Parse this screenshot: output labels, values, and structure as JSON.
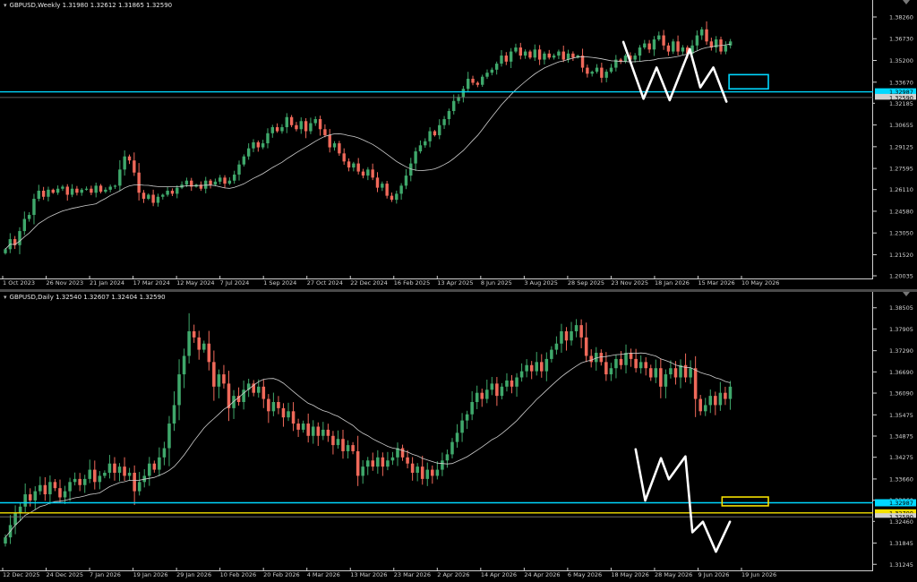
{
  "colors": {
    "background": "#000000",
    "bull": "#3fa86b",
    "bear": "#f0695a",
    "ma": "#cfcfcf",
    "cyan": "#00d8ff",
    "yellow": "#f5e000",
    "white_pattern": "#ffffff",
    "price_line": "#777777"
  },
  "panels": [
    {
      "id": "weekly",
      "title": "GBPUSD,Weekly  1.31980 1.32612 1.31865 1.32590",
      "y_ticks": [
        "1.38260",
        "1.36730",
        "1.35200",
        "1.33670",
        "1.32185",
        "1.30655",
        "1.29125",
        "1.27595",
        "1.26110",
        "1.24580",
        "1.23050",
        "1.21520",
        "1.20035"
      ],
      "y_range": [
        1.20035,
        1.387
      ],
      "x_ticks": [
        "1 Oct 2023",
        "26 Nov 2023",
        "21 Jan 2024",
        "17 Mar 2024",
        "12 May 2024",
        "7 Jul 2024",
        "1 Sep 2024",
        "27 Oct 2024",
        "22 Dec 2024",
        "16 Feb 2025",
        "13 Apr 2025",
        "8 Jun 2025",
        "3 Aug 2025",
        "28 Sep 2025",
        "23 Nov 2025",
        "18 Jan 2026",
        "15 Mar 2026",
        "10 May 2026"
      ],
      "current_price": 1.3259,
      "badges": [
        {
          "label": "1.32987",
          "value": 1.32987,
          "color": "#00d8ff",
          "text_color": "#000000"
        },
        {
          "label": "1.32590",
          "value": 1.3259,
          "color": "#d0d0d0",
          "text_color": "#000000"
        },
        {
          "label": "1.32185",
          "value": 1.32185,
          "color": "#000000",
          "text_color": "#d0d0d0"
        }
      ],
      "hlines": [
        {
          "value": 1.32987,
          "color": "#00d8ff"
        },
        {
          "value": 1.3259,
          "color": "#777777"
        }
      ],
      "box": {
        "y_top": 1.342,
        "y_bottom": 1.332,
        "color": "#00d8ff",
        "start": 0.835,
        "end": 0.88
      },
      "zigzag": [
        [
          0.714,
          1.365
        ],
        [
          0.737,
          1.325
        ],
        [
          0.752,
          1.347
        ],
        [
          0.767,
          1.324
        ],
        [
          0.79,
          1.36
        ],
        [
          0.802,
          1.333
        ],
        [
          0.817,
          1.347
        ],
        [
          0.832,
          1.323
        ]
      ],
      "series": {
        "start_price": 1.213,
        "ma_period": 20,
        "moves": [
          0.004,
          0.01,
          -0.006,
          0.014,
          0.012,
          0.004,
          0.016,
          0.008,
          -0.006,
          0.007,
          -0.003,
          0.004,
          0.002,
          -0.008,
          0.006,
          -0.004,
          0.003,
          0.001,
          -0.004,
          0.007,
          -0.006,
          0.002,
          0.003,
          0.001,
          0.016,
          0.013,
          -0.004,
          -0.012,
          -0.02,
          -0.006,
          0.004,
          -0.008,
          0.006,
          0.002,
          0.004,
          -0.003,
          0.006,
          0.003,
          0.004,
          -0.006,
          0.002,
          -0.004,
          0.008,
          -0.004,
          0.003,
          0.004,
          -0.006,
          0.003,
          0.006,
          0.01,
          0.008,
          0.008,
          0.006,
          -0.005,
          0.004,
          0.01,
          0.006,
          -0.004,
          0.004,
          0.01,
          -0.008,
          -0.004,
          0.008,
          -0.01,
          0.008,
          0.004,
          -0.01,
          -0.006,
          -0.012,
          0.004,
          -0.01,
          -0.008,
          -0.006,
          0.004,
          -0.008,
          -0.004,
          0.006,
          -0.008,
          -0.01,
          0.004,
          -0.012,
          -0.004,
          0.006,
          0.008,
          0.01,
          0.012,
          0.012,
          0.006,
          0.004,
          0.01,
          -0.004,
          0.01,
          0.006,
          0.008,
          0.01,
          0.004,
          0.008,
          0.01,
          -0.004,
          -0.002,
          0.008,
          0.004,
          0.003,
          0.006,
          0.008,
          -0.006,
          0.01,
          0.004,
          -0.008,
          0.004,
          -0.006,
          0.008,
          -0.01,
          0.006,
          -0.004,
          0.002,
          0.004,
          -0.008,
          0.006,
          -0.004,
          0.002,
          -0.012,
          -0.006,
          0.002,
          0.004,
          -0.01,
          0.006,
          0.004,
          0.008,
          -0.002,
          0.006,
          -0.004,
          0.004,
          0.008,
          0.004,
          -0.006,
          0.01,
          0.004,
          -0.01,
          -0.006,
          0.01,
          -0.01,
          0.004,
          -0.006,
          0.008,
          0.01,
          0.006,
          -0.012,
          -0.006,
          0.008,
          -0.012,
          0.006,
          0.004
        ]
      }
    },
    {
      "id": "daily",
      "title": "GBPUSD,Daily  1.32540 1.32607 1.32404 1.32590",
      "y_ticks": [
        "1.38505",
        "1.37905",
        "1.37290",
        "1.36690",
        "1.36090",
        "1.35475",
        "1.34875",
        "1.34275",
        "1.33660",
        "1.33060",
        "1.32460",
        "1.31845",
        "1.31245"
      ],
      "y_range": [
        1.3115,
        1.3865
      ],
      "x_ticks": [
        "12 Dec 2025",
        "24 Dec 2025",
        "7 Jan 2026",
        "19 Jan 2026",
        "29 Jan 2026",
        "10 Feb 2026",
        "20 Feb 2026",
        "4 Mar 2026",
        "13 Mar 2026",
        "23 Mar 2026",
        "2 Apr 2026",
        "14 Apr 2026",
        "24 Apr 2026",
        "6 May 2026",
        "18 May 2026",
        "28 May 2026",
        "9 Jun 2026",
        "19 Jun 2026"
      ],
      "current_price": 1.3259,
      "badges": [
        {
          "label": "1.32987",
          "value": 1.32987,
          "color": "#00d8ff",
          "text_color": "#000000"
        },
        {
          "label": "1.32700",
          "value": 1.327,
          "color": "#f5e000",
          "text_color": "#000000"
        },
        {
          "label": "1.32590",
          "value": 1.3259,
          "color": "#d0d0d0",
          "text_color": "#000000"
        },
        {
          "label": "1.32460",
          "value": 1.3246,
          "color": "#000000",
          "text_color": "#d0d0d0"
        }
      ],
      "hlines": [
        {
          "value": 1.32987,
          "color": "#00d8ff"
        },
        {
          "value": 1.327,
          "color": "#f5e000"
        },
        {
          "value": 1.3259,
          "color": "#777777"
        }
      ],
      "box": {
        "y_top": 1.3315,
        "y_bottom": 1.329,
        "color": "#f5e000",
        "start": 0.827,
        "end": 0.88
      },
      "zigzag": [
        [
          0.728,
          1.345
        ],
        [
          0.739,
          1.3305
        ],
        [
          0.757,
          1.3425
        ],
        [
          0.766,
          1.3365
        ],
        [
          0.785,
          1.343
        ],
        [
          0.793,
          1.3215
        ],
        [
          0.805,
          1.3245
        ],
        [
          0.82,
          1.316
        ],
        [
          0.836,
          1.3245
        ]
      ],
      "series": {
        "start_price": 1.336,
        "ma_period": 20,
        "moves": [
          0.002,
          0.004,
          0.004,
          0.002,
          0.004,
          -0.002,
          0.003,
          0.002,
          -0.003,
          0.004,
          -0.002,
          -0.003,
          0.002,
          0.003,
          0.001,
          -0.002,
          0.002,
          0.003,
          -0.004,
          0.002,
          0.001,
          0.003,
          -0.003,
          0.002,
          -0.003,
          0.001,
          -0.006,
          0.003,
          0.002,
          0.004,
          -0.002,
          0.004,
          0.003,
          0.008,
          0.006,
          0.01,
          0.006,
          0.008,
          -0.002,
          -0.004,
          0.002,
          -0.006,
          -0.008,
          0.004,
          -0.003,
          -0.008,
          0.004,
          -0.002,
          0.004,
          0.002,
          -0.003,
          0.002,
          -0.004,
          -0.004,
          0.003,
          -0.002,
          -0.003,
          0.002,
          -0.004,
          -0.002,
          0.002,
          -0.004,
          0.003,
          -0.003,
          0.002,
          -0.002,
          -0.003,
          0.002,
          -0.004,
          0.002,
          -0.002,
          -0.008,
          0.003,
          0.002,
          -0.002,
          0.003,
          -0.003,
          0.002,
          0.001,
          0.003,
          -0.003,
          -0.002,
          -0.003,
          0.002,
          -0.004,
          0.003,
          -0.002,
          0.002,
          0.003,
          0.002,
          0.004,
          0.003,
          0.004,
          0.002,
          0.004,
          0.003,
          -0.002,
          0.003,
          0.002,
          -0.004,
          0.003,
          0.002,
          -0.002,
          0.003,
          0.002,
          0.002,
          -0.002,
          0.003,
          -0.003,
          0.004,
          0.003,
          0.002,
          0.004,
          -0.003,
          0.003,
          0.002,
          -0.004,
          -0.006,
          -0.002,
          0.003,
          -0.003,
          -0.004,
          0.002,
          0.003,
          -0.002,
          0.004,
          -0.002,
          -0.003,
          0.002,
          -0.002,
          -0.003,
          0.003,
          -0.006,
          0.004,
          0.002,
          -0.003,
          0.004,
          -0.004,
          0.003,
          -0.01,
          -0.004,
          0.002,
          0.003,
          -0.003,
          0.004,
          -0.002,
          0.004
        ]
      }
    }
  ]
}
